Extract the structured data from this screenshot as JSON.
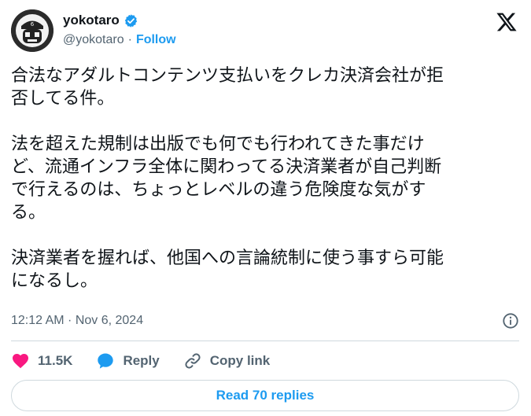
{
  "author": {
    "display_name": "yokotaro",
    "handle": "@yokotaro",
    "separator": "·",
    "follow_label": "Follow",
    "verified_color": "#1d9bf0"
  },
  "tweet": {
    "paragraphs": [
      [
        "合法なアダルトコンテンツ支払いをクレカ決済会社が拒",
        "否してる件。"
      ],
      [
        "法を超えた規制は出版でも何でも行われてきた事だけ",
        "ど、流通インフラ全体に関わってる決済業者が自己判断",
        "で行えるのは、ちょっとレベルの違う危険度な気がす",
        "る。"
      ],
      [
        "決済業者を握れば、他国への言論統制に使う事すら可能",
        "になるし。"
      ]
    ]
  },
  "meta": {
    "timestamp": "12:12 AM · Nov 6, 2024"
  },
  "actions": {
    "likes": "11.5K",
    "reply_label": "Reply",
    "copy_link_label": "Copy link",
    "read_replies_label": "Read 70 replies"
  },
  "colors": {
    "like": "#f91880",
    "reply": "#1d9bf0",
    "link": "#536471",
    "accent": "#1d9bf0"
  },
  "icons": {
    "brand": "x-logo-icon",
    "verified": "verified-badge-icon",
    "info": "info-icon",
    "like": "heart-icon",
    "reply": "speech-bubble-icon",
    "copy_link": "link-icon"
  }
}
